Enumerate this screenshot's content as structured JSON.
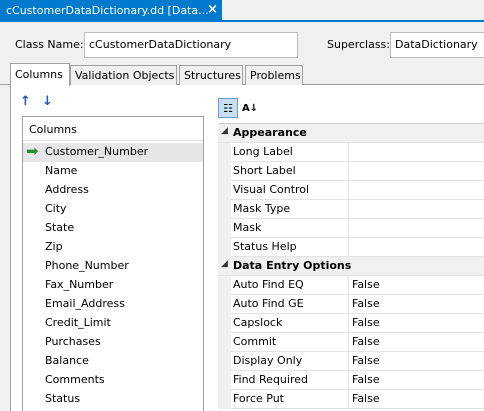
{
  "document_tab": {
    "title": "cCustomerDataDictionary.dd [Data...",
    "close_icon": "close-icon"
  },
  "class_row": {
    "class_name_label": "Class Name:",
    "class_name_value": "cCustomerDataDictionary",
    "superclass_label": "Superclass:",
    "superclass_value": "DataDictionary"
  },
  "tabs": [
    {
      "label": "Columns",
      "active": true
    },
    {
      "label": "Validation Objects",
      "active": false
    },
    {
      "label": "Structures",
      "active": false
    },
    {
      "label": "Problems",
      "active": false
    }
  ],
  "toolbar": {
    "move_up_icon": "arrow-up-icon",
    "move_down_icon": "arrow-down-icon"
  },
  "columns": {
    "header": "Columns",
    "items": [
      "Customer_Number",
      "Name",
      "Address",
      "City",
      "State",
      "Zip",
      "Phone_Number",
      "Fax_Number",
      "Email_Address",
      "Credit_Limit",
      "Purchases",
      "Balance",
      "Comments",
      "Status"
    ],
    "selected_index": 0
  },
  "property_toolbar": {
    "categorized_icon": "categorized-icon",
    "alphabetical_icon": "sort-az-icon"
  },
  "properties": [
    {
      "category": "Appearance",
      "items": [
        {
          "name": "Long Label",
          "value": ""
        },
        {
          "name": "Short Label",
          "value": ""
        },
        {
          "name": "Visual Control",
          "value": ""
        },
        {
          "name": "Mask Type",
          "value": ""
        },
        {
          "name": "Mask",
          "value": ""
        },
        {
          "name": "Status Help",
          "value": ""
        }
      ]
    },
    {
      "category": "Data Entry Options",
      "items": [
        {
          "name": "Auto Find EQ",
          "value": "False"
        },
        {
          "name": "Auto Find GE",
          "value": "False"
        },
        {
          "name": "Capslock",
          "value": "False"
        },
        {
          "name": "Commit",
          "value": "False"
        },
        {
          "name": "Display Only",
          "value": "False"
        },
        {
          "name": "Find Required",
          "value": "False"
        },
        {
          "name": "Force Put",
          "value": "False"
        }
      ]
    }
  ]
}
